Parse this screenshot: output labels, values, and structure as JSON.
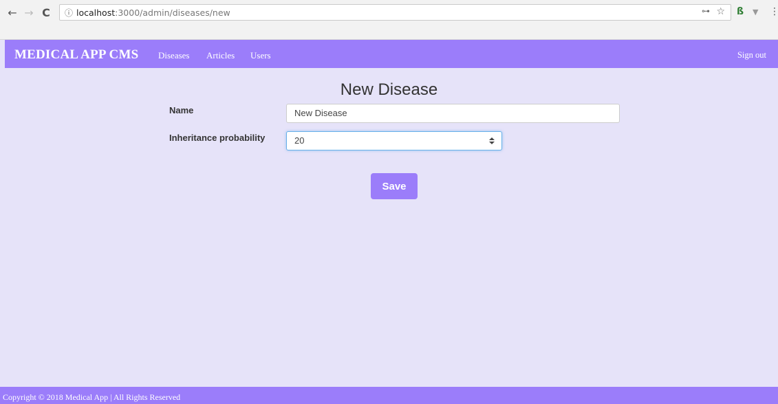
{
  "browser": {
    "back_icon": "←",
    "forward_icon": "→",
    "reload_icon": "C",
    "info_icon": "ⓘ",
    "url_host": "localhost",
    "url_path": ":3000/admin/diseases/new",
    "key_icon": "⊶",
    "star_icon": "☆",
    "ext1_icon": "ß",
    "ext2_icon": "▼",
    "menu_icon": "⋮"
  },
  "navbar": {
    "brand": "MEDICAL APP CMS",
    "links": [
      "Diseases",
      "Articles",
      "Users"
    ],
    "sign_out": "Sign out",
    "color": "#9b7dfa"
  },
  "page": {
    "title": "New Disease",
    "fields": {
      "name_label": "Name",
      "name_value": "New Disease",
      "probability_label": "Inheritance probability",
      "probability_value": "20"
    },
    "save_label": "Save"
  },
  "footer": {
    "text": "Copyright © 2018 Medical App | All Rights Reserved"
  },
  "colors": {
    "background": "#e6e3f9",
    "accent": "#9b7dfa"
  }
}
